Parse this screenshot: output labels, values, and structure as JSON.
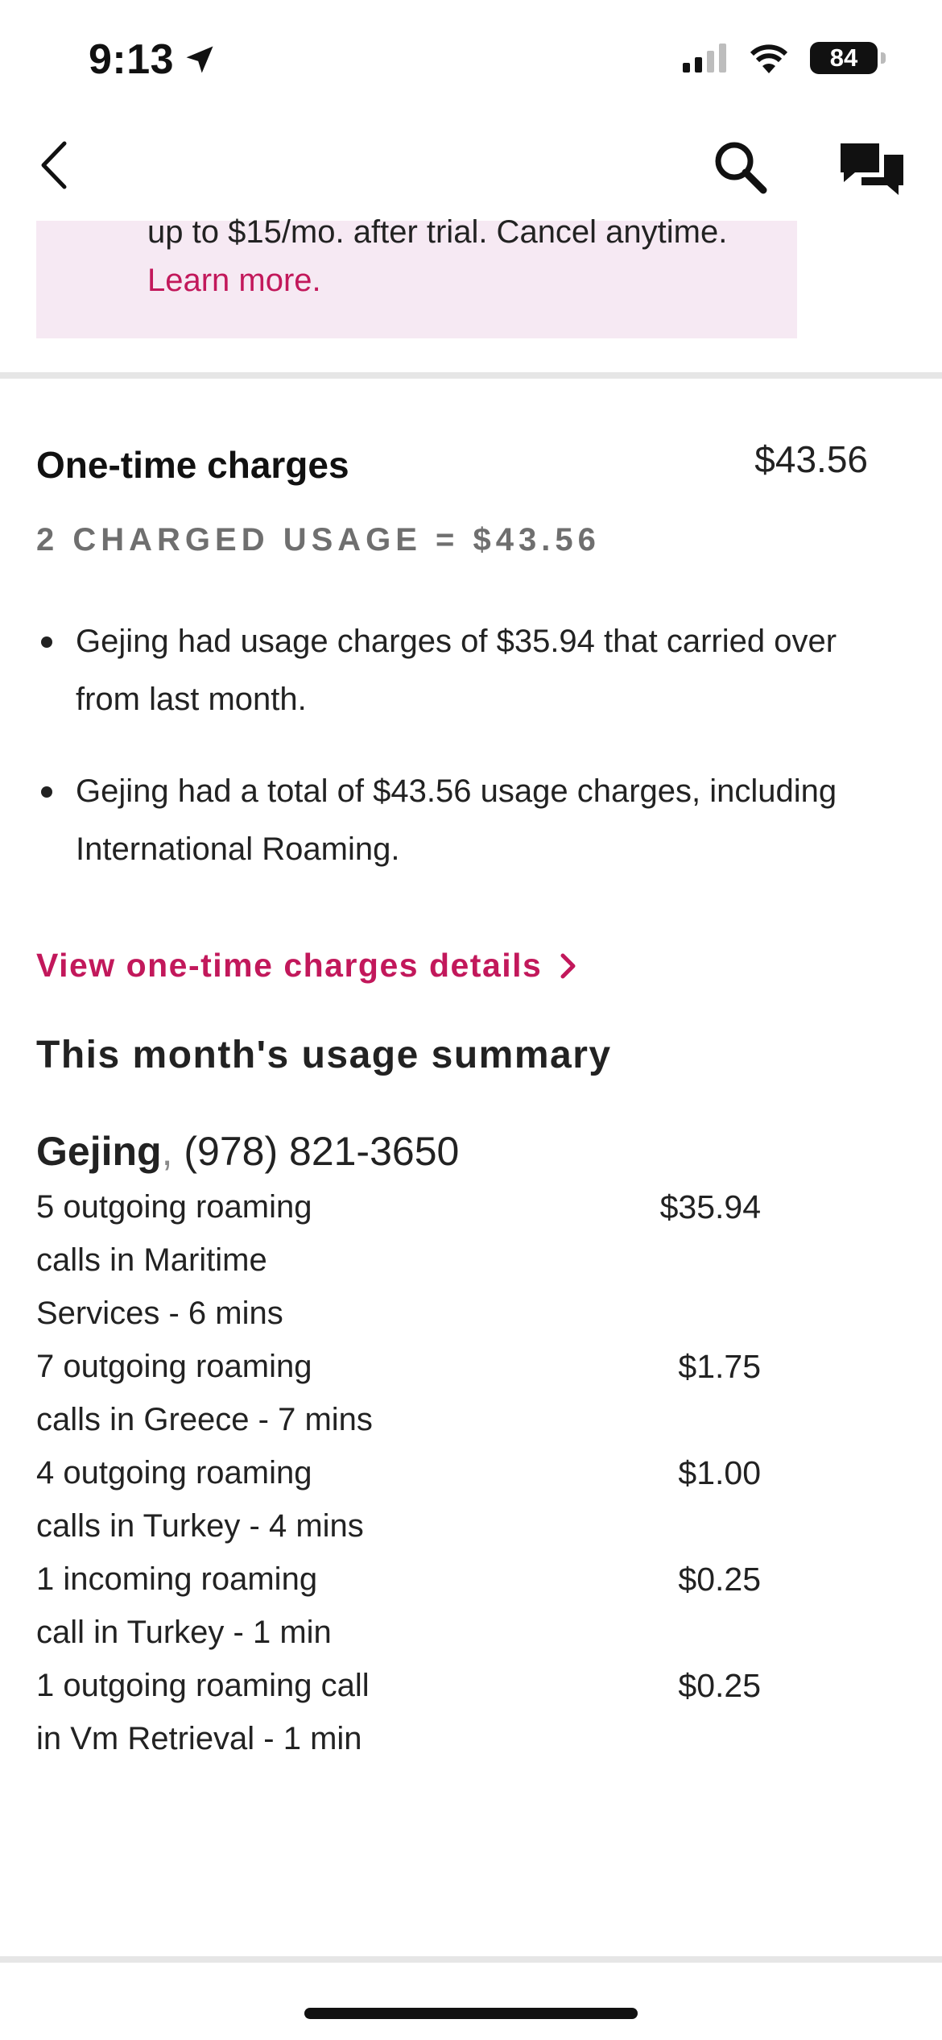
{
  "status_bar": {
    "time": "9:13",
    "battery": "84"
  },
  "promo": {
    "text": "up to $15/mo. after trial. Cancel anytime.",
    "link": "Learn more."
  },
  "one_time_charges": {
    "title": "One-time charges",
    "amount": "$43.56",
    "charged_usage": "2 CHARGED USAGE = $43.56",
    "bullets": [
      "Gejing had usage charges of $35.94 that carried over from last month.",
      "Gejing had a total of $43.56 usage charges, including International Roaming."
    ],
    "details_link": "View one-time charges details"
  },
  "usage_summary": {
    "title": "This month's usage summary",
    "line_name": "Gejing",
    "line_separator": ",",
    "line_number": "(978) 821-3650",
    "items": [
      {
        "description": "5 outgoing roaming calls in Maritime Services - 6 mins",
        "amount": "$35.94"
      },
      {
        "description": "7 outgoing roaming calls in Greece - 7 mins",
        "amount": "$1.75"
      },
      {
        "description": "4 outgoing roaming calls in Turkey - 4 mins",
        "amount": "$1.00"
      },
      {
        "description": "1 incoming roaming call in Turkey - 1 min",
        "amount": "$0.25"
      },
      {
        "description": "1 outgoing roaming call in Vm Retrieval - 1 min",
        "amount": "$0.25"
      }
    ]
  },
  "icons": {
    "back": "chevron-left-icon",
    "search": "search-icon",
    "chat": "chat-bubbles-icon",
    "location": "location-arrow-icon",
    "signal": "cellular-signal-icon",
    "wifi": "wifi-icon"
  },
  "colors": {
    "accent": "#c2185b",
    "promo_bg": "#f6e9f3",
    "muted": "#6f6f6f"
  }
}
